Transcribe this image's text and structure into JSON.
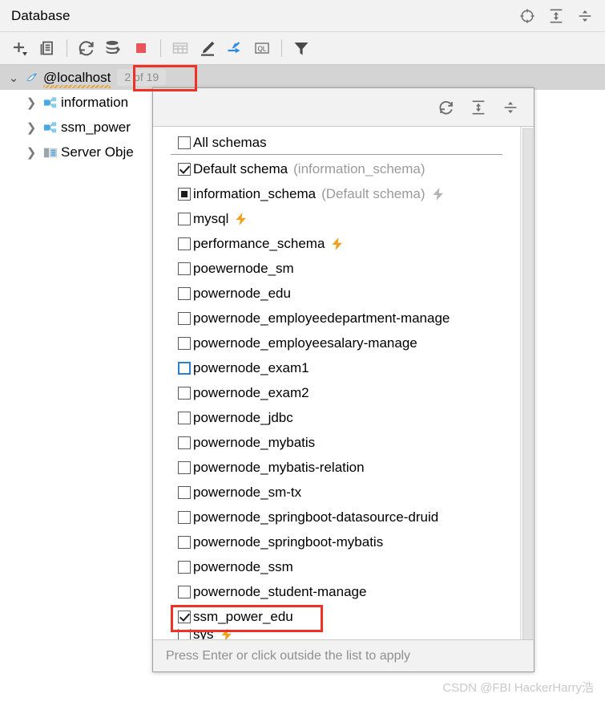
{
  "window": {
    "title": "Database",
    "title_icons": [
      {
        "name": "scroll-from-source-icon",
        "label": "Scroll from Source"
      },
      {
        "name": "expand-all-icon",
        "label": "Expand All"
      },
      {
        "name": "collapse-all-icon",
        "label": "Collapse All"
      }
    ]
  },
  "toolbar": {
    "buttons": [
      {
        "name": "add-button",
        "label": "New"
      },
      {
        "name": "copy-button",
        "label": "Duplicate"
      },
      {
        "name": "refresh-button",
        "label": "Refresh"
      },
      {
        "name": "data-source-properties-button",
        "label": "Data Source Properties"
      },
      {
        "name": "stop-button",
        "label": "Stop"
      },
      {
        "name": "open-table-button",
        "label": "Open Table Editor"
      },
      {
        "name": "modify-button",
        "label": "Modify"
      },
      {
        "name": "jump-to-button",
        "label": "Jump to Query Console"
      },
      {
        "name": "query-console-button",
        "label": "QL"
      },
      {
        "name": "filter-button",
        "label": "Filter"
      }
    ]
  },
  "tree": {
    "root": {
      "name": "data-source-localhost",
      "label": "@localhost",
      "badge": "2 of 19",
      "expanded": true,
      "icon": "mysql-dolphin-icon"
    },
    "children": [
      {
        "label": "information",
        "icon": "schema-icon",
        "expanded": false
      },
      {
        "label": "ssm_power",
        "icon": "schema-icon",
        "expanded": false
      },
      {
        "label": "Server Obje",
        "icon": "server-objects-icon",
        "expanded": false
      }
    ]
  },
  "popup": {
    "header_icons": [
      {
        "name": "refresh-icon",
        "label": "Refresh"
      },
      {
        "name": "expand-all-icon",
        "label": "Expand All"
      },
      {
        "name": "collapse-all-icon",
        "label": "Collapse All"
      }
    ],
    "footer_hint": "Press Enter or click outside the list to apply",
    "items": [
      {
        "label": "All schemas",
        "state": "unchecked",
        "hint": "",
        "bolt": "none",
        "separator": true,
        "focused": false
      },
      {
        "label": "Default schema",
        "state": "checked",
        "hint": "(information_schema)",
        "bolt": "none",
        "separator": false,
        "focused": false
      },
      {
        "label": "information_schema",
        "state": "partial",
        "hint": "(Default schema)",
        "bolt": "gray",
        "separator": false,
        "focused": false
      },
      {
        "label": "mysql",
        "state": "unchecked",
        "hint": "",
        "bolt": "orange",
        "separator": false,
        "focused": false
      },
      {
        "label": "performance_schema",
        "state": "unchecked",
        "hint": "",
        "bolt": "orange",
        "separator": false,
        "focused": false
      },
      {
        "label": "poewernode_sm",
        "state": "unchecked",
        "hint": "",
        "bolt": "none",
        "separator": false,
        "focused": false
      },
      {
        "label": "powernode_edu",
        "state": "unchecked",
        "hint": "",
        "bolt": "none",
        "separator": false,
        "focused": false
      },
      {
        "label": "powernode_employeedepartment-manage",
        "state": "unchecked",
        "hint": "",
        "bolt": "none",
        "separator": false,
        "focused": false
      },
      {
        "label": "powernode_employeesalary-manage",
        "state": "unchecked",
        "hint": "",
        "bolt": "none",
        "separator": false,
        "focused": false
      },
      {
        "label": "powernode_exam1",
        "state": "unchecked",
        "hint": "",
        "bolt": "none",
        "separator": false,
        "focused": true
      },
      {
        "label": "powernode_exam2",
        "state": "unchecked",
        "hint": "",
        "bolt": "none",
        "separator": false,
        "focused": false
      },
      {
        "label": "powernode_jdbc",
        "state": "unchecked",
        "hint": "",
        "bolt": "none",
        "separator": false,
        "focused": false
      },
      {
        "label": "powernode_mybatis",
        "state": "unchecked",
        "hint": "",
        "bolt": "none",
        "separator": false,
        "focused": false
      },
      {
        "label": "powernode_mybatis-relation",
        "state": "unchecked",
        "hint": "",
        "bolt": "none",
        "separator": false,
        "focused": false
      },
      {
        "label": "powernode_sm-tx",
        "state": "unchecked",
        "hint": "",
        "bolt": "none",
        "separator": false,
        "focused": false
      },
      {
        "label": "powernode_springboot-datasource-druid",
        "state": "unchecked",
        "hint": "",
        "bolt": "none",
        "separator": false,
        "focused": false
      },
      {
        "label": "powernode_springboot-mybatis",
        "state": "unchecked",
        "hint": "",
        "bolt": "none",
        "separator": false,
        "focused": false
      },
      {
        "label": "powernode_ssm",
        "state": "unchecked",
        "hint": "",
        "bolt": "none",
        "separator": false,
        "focused": false
      },
      {
        "label": "powernode_student-manage",
        "state": "unchecked",
        "hint": "",
        "bolt": "none",
        "separator": false,
        "focused": false
      },
      {
        "label": "ssm_power_edu",
        "state": "checked",
        "hint": "",
        "bolt": "none",
        "separator": false,
        "focused": false
      },
      {
        "label": "sys",
        "state": "unchecked",
        "hint": "",
        "bolt": "orange",
        "separator": false,
        "focused": false,
        "clipped": true
      }
    ]
  },
  "annotations": {
    "highlight_color": "#f03226",
    "highlighted_badge": "2 of 19",
    "highlighted_item": "ssm_power_edu"
  },
  "watermark": {
    "text": "CSDN @FBI HackerHarry浩"
  },
  "colors": {
    "accent_blue": "#2b7fd4",
    "bolt_orange": "#f0a01e",
    "bolt_gray": "#b4b4b4",
    "stop_red": "#e8565a",
    "chrome_gray": "#f2f2f2",
    "selection_gray": "#d4d4d4"
  }
}
